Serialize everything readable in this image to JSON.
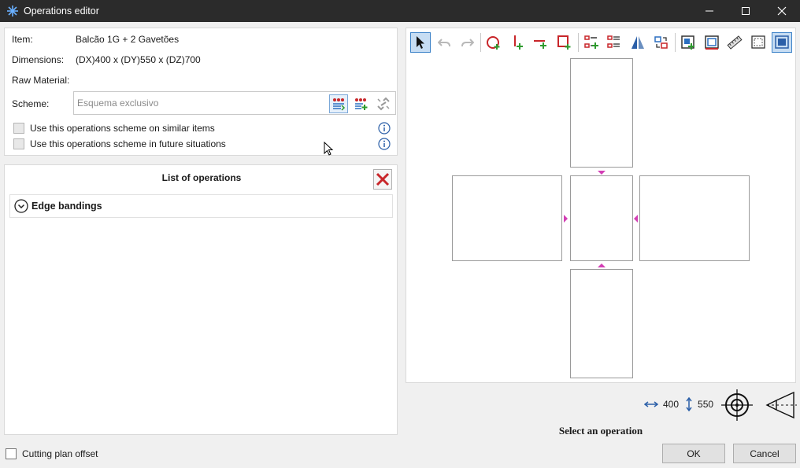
{
  "window": {
    "title": "Operations editor"
  },
  "item": {
    "item_label": "Item:",
    "item_value": "Balcão 1G + 2 Gavetões",
    "dimensions_label": "Dimensions:",
    "dimensions_value": "(DX)400 x (DY)550 x (DZ)700",
    "raw_material_label": "Raw Material:",
    "scheme_label": "Scheme:",
    "scheme_placeholder": "Esquema exclusivo",
    "similar_items_label": "Use this operations scheme on similar items",
    "future_situations_label": "Use this operations scheme in future situations",
    "similar_items_checked": false,
    "future_situations_checked": false
  },
  "operations": {
    "title": "List of operations",
    "groups": [
      {
        "label": "Edge bandings",
        "expanded": false
      }
    ]
  },
  "toolbar": {
    "icons": [
      "select-arrow-icon",
      "undo-icon",
      "redo-icon",
      "add-circle-icon",
      "add-vertical-cut-icon",
      "add-horizontal-cut-icon",
      "add-rectangle-icon",
      "add-list-icon",
      "list-settings-icon",
      "mirror-icon",
      "swap-faces-icon",
      "add-panel-icon",
      "panel-frame-icon",
      "ruler-icon",
      "dashed-frame-icon",
      "fit-frame-icon",
      "more-icon"
    ]
  },
  "dimensions": {
    "width": "400",
    "height": "550"
  },
  "status": {
    "message": "Select an operation"
  },
  "footer": {
    "cutting_plan_label": "Cutting plan offset",
    "cutting_plan_checked": false,
    "ok_label": "OK",
    "cancel_label": "Cancel"
  },
  "colors": {
    "accent_magenta": "#d33fb5",
    "accent_red": "#c8262a",
    "accent_green": "#2e9a2e",
    "accent_blue": "#2b6fc0"
  }
}
